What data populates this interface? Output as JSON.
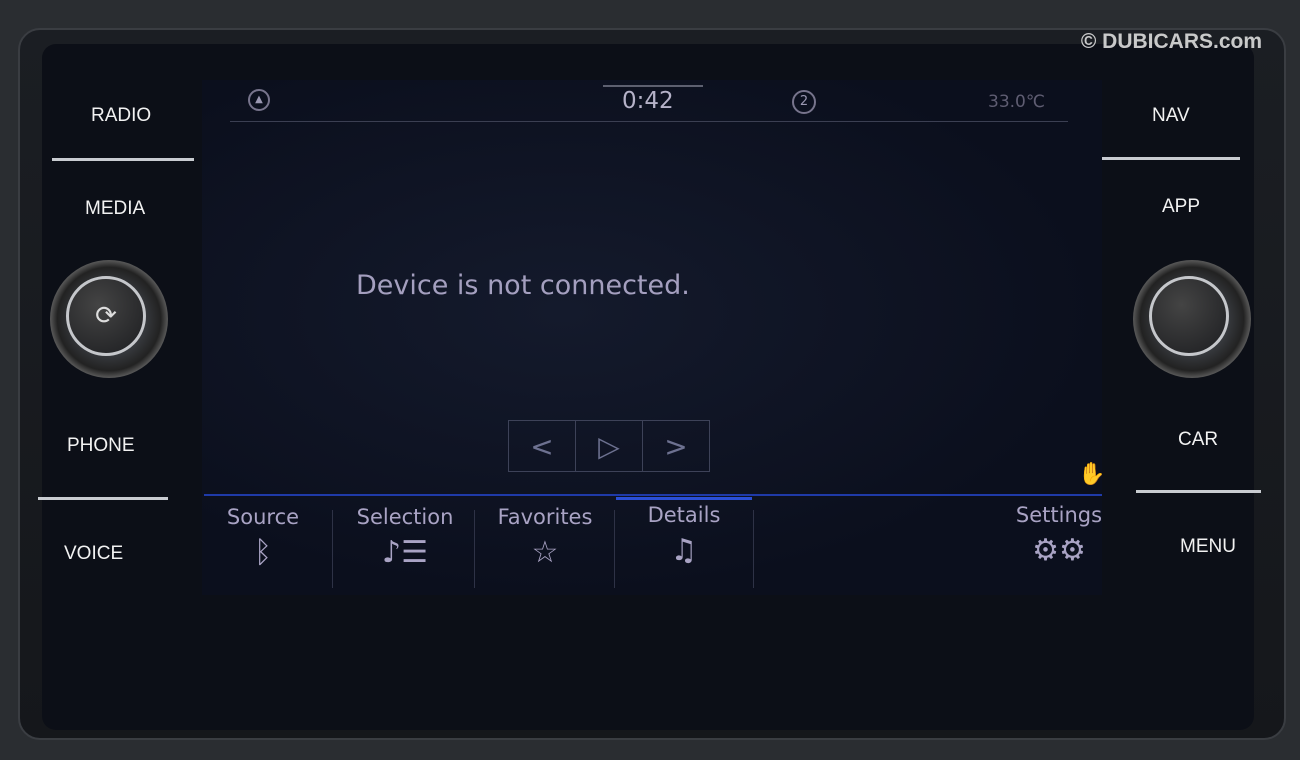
{
  "watermark": "© DUBICARS.com",
  "hard_buttons": {
    "radio": "RADIO",
    "media": "MEDIA",
    "phone": "PHONE",
    "voice": "VOICE",
    "nav": "NAV",
    "app": "APP",
    "car": "CAR",
    "menu": "MENU"
  },
  "status_bar": {
    "time": "0:42",
    "temperature": "33.0℃",
    "nav_icon": "navigation-arrow-icon",
    "badge": "2"
  },
  "message": "Device is not connected.",
  "playback": {
    "prev": "<",
    "play": "▷",
    "next": ">"
  },
  "tabs": [
    {
      "label": "Source",
      "icon": "bluetooth-icon"
    },
    {
      "label": "Selection",
      "icon": "playlist-icon"
    },
    {
      "label": "Favorites",
      "icon": "star-icon"
    },
    {
      "label": "Details",
      "icon": "music-note-icon",
      "active": true
    },
    {
      "label": "Settings",
      "icon": "gears-icon"
    }
  ],
  "colors": {
    "accent": "#2a4fd6",
    "text": "#a9a3c4"
  }
}
